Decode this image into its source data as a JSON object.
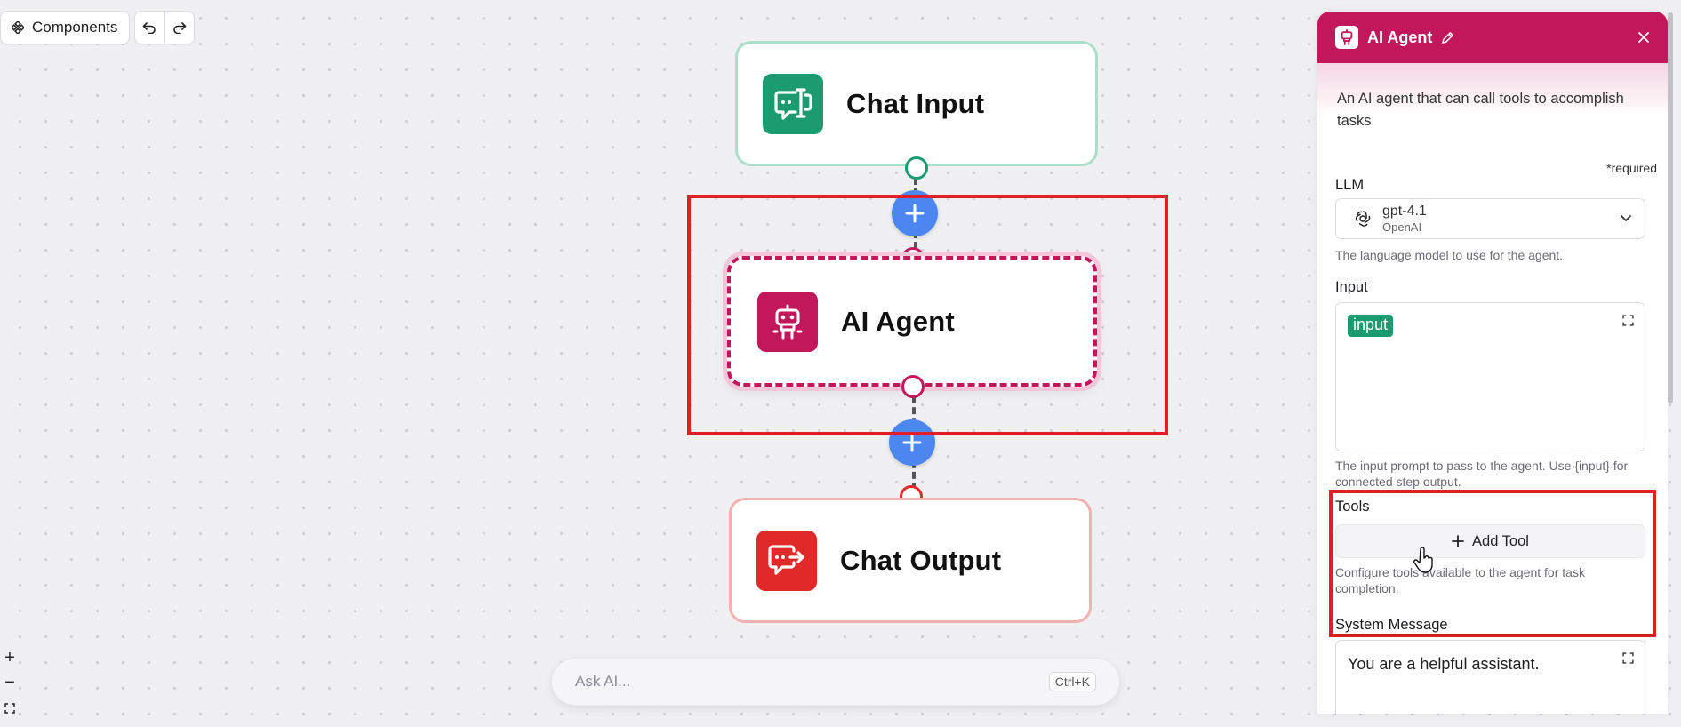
{
  "toolbar": {
    "components_label": "Components",
    "undo_icon": "undo-icon",
    "redo_icon": "redo-icon"
  },
  "zoom": {
    "in": "+",
    "out": "−"
  },
  "nodes": [
    {
      "id": "chat-input",
      "title": "Chat Input",
      "color": "#1b9b6f",
      "icon": "chat-input-icon"
    },
    {
      "id": "ai-agent",
      "title": "AI Agent",
      "color": "#c2185b",
      "icon": "robot-icon"
    },
    {
      "id": "chat-output",
      "title": "Chat Output",
      "color": "#e02a2a",
      "icon": "chat-output-icon"
    }
  ],
  "ask_ai": {
    "placeholder": "Ask AI...",
    "shortcut": "Ctrl+K"
  },
  "panel": {
    "title": "AI Agent",
    "description": "An AI agent that can call tools to accomplish tasks",
    "required_note": "*required",
    "accent_color": "#c2185b",
    "llm": {
      "label": "LLM",
      "model": "gpt-4.1",
      "provider": "OpenAI",
      "help": "The language model to use for the agent."
    },
    "input": {
      "label": "Input",
      "chip": "input",
      "help": "The input prompt to pass to the agent. Use {input} for connected step output."
    },
    "tools": {
      "label": "Tools",
      "add_button": "Add Tool",
      "help": "Configure tools available to the agent for task completion."
    },
    "system_message": {
      "label": "System Message",
      "value": "You are a helpful assistant."
    }
  },
  "highlight_color": "#e01e26"
}
